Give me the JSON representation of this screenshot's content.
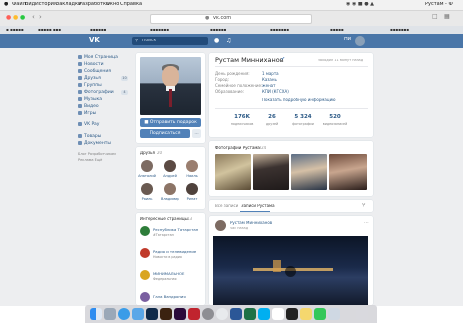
{
  "menubar": {
    "apple": "",
    "items": [
      "Файл",
      "Вид",
      "История",
      "Закладки",
      "Разработка",
      "Окно",
      "Справка"
    ],
    "right_items": [
      "Рустам - Ф"
    ]
  },
  "browser": {
    "url": "vk.com"
  },
  "vk": {
    "logo": "VK",
    "search_placeholder": "Поиск",
    "user_label": "Ни"
  },
  "left_menu": {
    "items": [
      {
        "label": "Моя Страница",
        "icon": "home-icon"
      },
      {
        "label": "Новости",
        "icon": "news-icon"
      },
      {
        "label": "Сообщения",
        "icon": "message-icon"
      },
      {
        "label": "Друзья",
        "icon": "friends-icon",
        "count": "10"
      },
      {
        "label": "Группы",
        "icon": "groups-icon"
      },
      {
        "label": "Фотографии",
        "icon": "photo-icon",
        "count": "4"
      },
      {
        "label": "Музыка",
        "icon": "music-icon"
      },
      {
        "label": "Видео",
        "icon": "video-icon"
      },
      {
        "label": "Игры",
        "icon": "games-icon"
      },
      {
        "label": "VK Pay",
        "icon": "pay-icon"
      },
      {
        "label": "Товары",
        "icon": "goods-icon"
      },
      {
        "label": "Документы",
        "icon": "docs-icon"
      }
    ],
    "footer": [
      "Блог Разработчикам",
      "Реклама Ещё"
    ]
  },
  "profile_actions": {
    "message_button": "Отправить подарок",
    "subscribe_button": "Подписаться",
    "more_button": "..."
  },
  "friends_block": {
    "title": "Друзья",
    "count": "20",
    "names": [
      "Анатолий",
      "Андрей",
      "Наиль",
      "Раиль",
      "Владимир",
      "Ринат"
    ]
  },
  "pages_block": {
    "title": "Интересные страницы",
    "count": "13",
    "items": [
      {
        "name": "Республика Татарстан",
        "sub": "#Татарстан"
      },
      {
        "name": "Радио и телевидение",
        "sub": "Новости в радио"
      },
      {
        "name": "МИНИМАЛЬНОЕ",
        "sub": "Федеральная"
      },
      {
        "name": "Гала Вандрония",
        "sub": ""
      }
    ]
  },
  "profile": {
    "name": "Рустам Минниханов",
    "online": "заходил 11 минут назад",
    "info": [
      {
        "label": "День рождения:",
        "value": "1 марта"
      },
      {
        "label": "Город:",
        "value": "Казань"
      },
      {
        "label": "Семейное положение:",
        "value": "женат"
      },
      {
        "label": "Образование:",
        "value": "КПИ (КГСХА)"
      }
    ],
    "more_info": "Показать подробную информацию",
    "stats": [
      {
        "num": "176K",
        "label": "подписчиков"
      },
      {
        "num": "26",
        "label": "друзей"
      },
      {
        "num": "5 324",
        "label": "фотографии"
      },
      {
        "num": "520",
        "label": "видеозаписей"
      }
    ]
  },
  "photos_block": {
    "title": "Фотографии Рустама",
    "count": "5324"
  },
  "wall": {
    "tabs": [
      "Все записи",
      "Записи Рустама"
    ],
    "post_author": "Рустам Минниханов",
    "post_time": "час назад"
  },
  "dock": {
    "icons": [
      "finder-icon",
      "launchpad-icon",
      "safari-icon",
      "mail-icon",
      "photoshop-icon",
      "illustrator-icon",
      "premiere-icon",
      "acrobat-icon",
      "settings-icon",
      "chrome-icon",
      "word-icon",
      "excel-icon",
      "skype-icon",
      "calendar-icon",
      "terminal-icon",
      "notes-icon",
      "messages-icon",
      "preview-icon",
      "trash-icon"
    ]
  }
}
